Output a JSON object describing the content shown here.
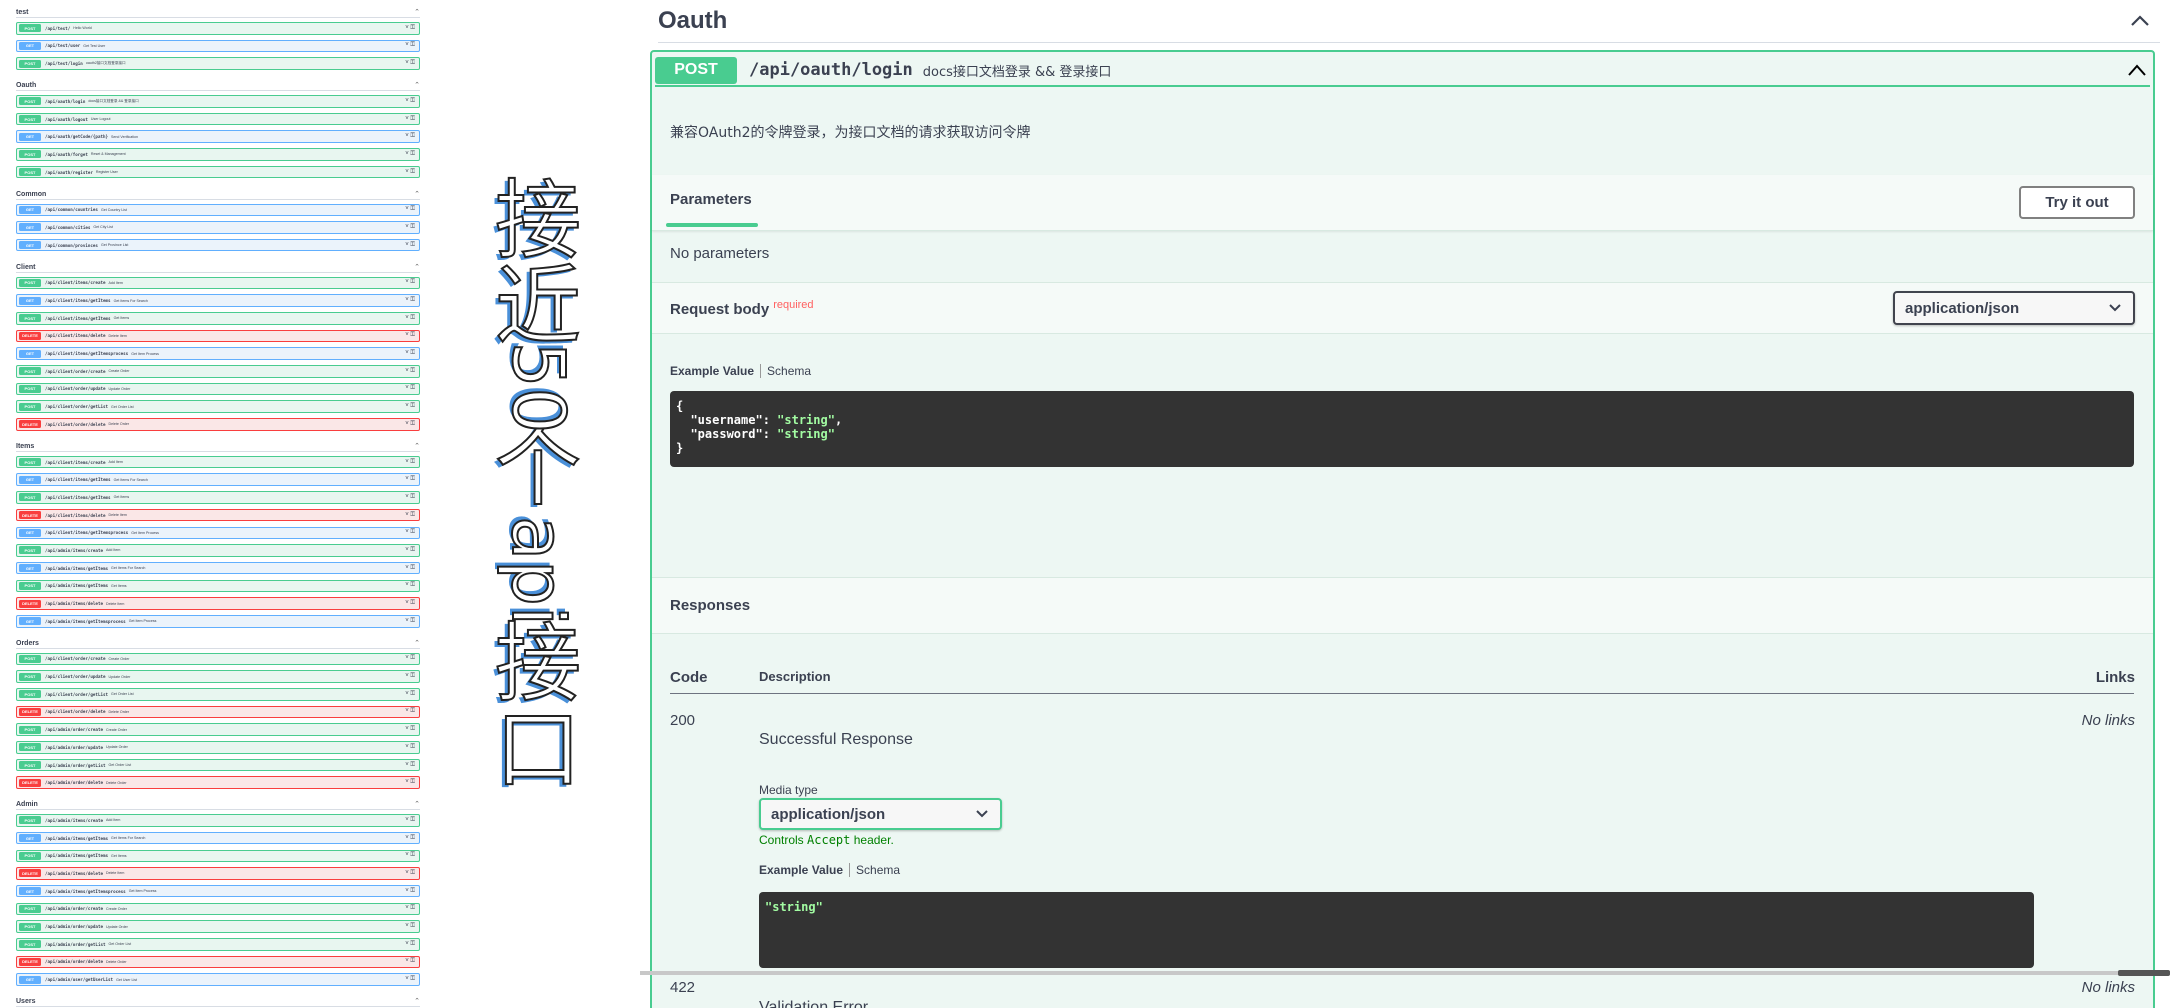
{
  "left_groups": [
    {
      "name": "test",
      "ops": [
        {
          "method": "POST",
          "path": "/api/test/",
          "summary": "Hello World"
        },
        {
          "method": "GET",
          "path": "/api/test/user",
          "summary": "Get Test User"
        },
        {
          "method": "POST",
          "path": "/api/test/login",
          "summary": "oauth2接口文档登录接口"
        }
      ]
    },
    {
      "name": "Oauth",
      "ops": [
        {
          "method": "POST",
          "path": "/api/oauth/login",
          "summary": "docs接口文档登录 && 登录接口"
        },
        {
          "method": "POST",
          "path": "/api/oauth/logout",
          "summary": "User Logout"
        },
        {
          "method": "GET",
          "path": "/api/oauth/getCode/{path}",
          "summary": "Send Verification"
        },
        {
          "method": "POST",
          "path": "/api/oauth/forget",
          "summary": "Reset & Management"
        },
        {
          "method": "POST",
          "path": "/api/oauth/register",
          "summary": "Register User"
        }
      ]
    },
    {
      "name": "Common",
      "ops": [
        {
          "method": "GET",
          "path": "/api/common/countries",
          "summary": "Get Country List"
        },
        {
          "method": "GET",
          "path": "/api/common/cities",
          "summary": "Get City List"
        },
        {
          "method": "GET",
          "path": "/api/common/provinces",
          "summary": "Get Province List"
        }
      ]
    },
    {
      "name": "Client",
      "ops": [
        {
          "method": "POST",
          "path": "/api/client/items/create",
          "summary": "Add Item"
        },
        {
          "method": "GET",
          "path": "/api/client/items/getItems",
          "summary": "Get Items For Search"
        },
        {
          "method": "POST",
          "path": "/api/client/items/getItems",
          "summary": "Get Items"
        },
        {
          "method": "DELETE",
          "path": "/api/client/items/delete",
          "summary": "Delete Item"
        },
        {
          "method": "GET",
          "path": "/api/client/items/getItemsprocess",
          "summary": "Get Item Process"
        },
        {
          "method": "POST",
          "path": "/api/client/order/create",
          "summary": "Create Order"
        },
        {
          "method": "POST",
          "path": "/api/client/order/update",
          "summary": "Update Order"
        },
        {
          "method": "POST",
          "path": "/api/client/order/getList",
          "summary": "Get Order List"
        },
        {
          "method": "DELETE",
          "path": "/api/client/order/delete",
          "summary": "Delete Order"
        }
      ]
    },
    {
      "name": "Items",
      "ops": [
        {
          "method": "POST",
          "path": "/api/client/items/create",
          "summary": "Add Item"
        },
        {
          "method": "GET",
          "path": "/api/client/items/getItems",
          "summary": "Get Items For Search"
        },
        {
          "method": "POST",
          "path": "/api/client/items/getItems",
          "summary": "Get Items"
        },
        {
          "method": "DELETE",
          "path": "/api/client/items/delete",
          "summary": "Delete Item"
        },
        {
          "method": "GET",
          "path": "/api/client/items/getItemsprocess",
          "summary": "Get Item Process"
        },
        {
          "method": "POST",
          "path": "/api/admin/items/create",
          "summary": "Add Item"
        },
        {
          "method": "GET",
          "path": "/api/admin/items/getItems",
          "summary": "Get Items For Search"
        },
        {
          "method": "POST",
          "path": "/api/admin/items/getItems",
          "summary": "Get Items"
        },
        {
          "method": "DELETE",
          "path": "/api/admin/items/delete",
          "summary": "Delete Item"
        },
        {
          "method": "GET",
          "path": "/api/admin/items/getItemsprocess",
          "summary": "Get Item Process"
        }
      ]
    },
    {
      "name": "Orders",
      "ops": [
        {
          "method": "POST",
          "path": "/api/client/order/create",
          "summary": "Create Order"
        },
        {
          "method": "POST",
          "path": "/api/client/order/update",
          "summary": "Update Order"
        },
        {
          "method": "POST",
          "path": "/api/client/order/getList",
          "summary": "Get Order List"
        },
        {
          "method": "DELETE",
          "path": "/api/client/order/delete",
          "summary": "Delete Order"
        },
        {
          "method": "POST",
          "path": "/api/admin/order/create",
          "summary": "Create Order"
        },
        {
          "method": "POST",
          "path": "/api/admin/order/update",
          "summary": "Update Order"
        },
        {
          "method": "POST",
          "path": "/api/admin/order/getList",
          "summary": "Get Order List"
        },
        {
          "method": "DELETE",
          "path": "/api/admin/order/delete",
          "summary": "Delete Order"
        }
      ]
    },
    {
      "name": "Admin",
      "ops": [
        {
          "method": "POST",
          "path": "/api/admin/items/create",
          "summary": "Add Item"
        },
        {
          "method": "GET",
          "path": "/api/admin/items/getItems",
          "summary": "Get Items For Search"
        },
        {
          "method": "POST",
          "path": "/api/admin/items/getItems",
          "summary": "Get Items"
        },
        {
          "method": "DELETE",
          "path": "/api/admin/items/delete",
          "summary": "Delete Item"
        },
        {
          "method": "GET",
          "path": "/api/admin/items/getItemsprocess",
          "summary": "Get Item Process"
        },
        {
          "method": "POST",
          "path": "/api/admin/order/create",
          "summary": "Create Order"
        },
        {
          "method": "POST",
          "path": "/api/admin/order/update",
          "summary": "Update Order"
        },
        {
          "method": "POST",
          "path": "/api/admin/order/getList",
          "summary": "Get Order List"
        },
        {
          "method": "DELETE",
          "path": "/api/admin/order/delete",
          "summary": "Delete Order"
        },
        {
          "method": "GET",
          "path": "/api/admin/user/getUserList",
          "summary": "Get User List"
        }
      ]
    },
    {
      "name": "Users",
      "ops": [
        {
          "method": "GET",
          "path": "/api/admin/user/getUserList",
          "summary": "Get User List"
        }
      ]
    }
  ],
  "vertical_title": [
    "接",
    "近",
    "50",
    "个",
    "api",
    "接",
    "口"
  ],
  "section": {
    "title": "Oauth"
  },
  "operation": {
    "method": "POST",
    "path": "/api/oauth/login",
    "summary": "docs接口文档登录 && 登录接口",
    "description": "兼容OAuth2的令牌登录，为接口文档的请求获取访问令牌",
    "parameters_tab": "Parameters",
    "try_button": "Try it out",
    "no_parameters": "No parameters",
    "request_body_title": "Request body",
    "required_label": "required",
    "request_content_type": "application/json",
    "example_value_label": "Example Value",
    "schema_label": "Schema",
    "request_example": {
      "open": "{",
      "username_key": "\"username\"",
      "username_value": "\"string\"",
      "password_key": "\"password\"",
      "password_value": "\"string\"",
      "close": "}"
    },
    "responses_title": "Responses",
    "table_headers": {
      "code": "Code",
      "description": "Description",
      "links": "Links"
    },
    "responses": [
      {
        "code": "200",
        "description": "Successful Response",
        "links": "No links"
      },
      {
        "code": "422",
        "description": "Validation Error",
        "links": "No links"
      }
    ],
    "media_type_label": "Media type",
    "response_content_type": "application/json",
    "controls_prefix": "Controls",
    "controls_code": "Accept",
    "controls_suffix": "header.",
    "response_example": "\"string\""
  },
  "colors": {
    "post": "#49cc90",
    "get": "#61affe",
    "delete": "#f93e3e",
    "code_bg": "#333333",
    "code_string": "#a2fca2"
  }
}
